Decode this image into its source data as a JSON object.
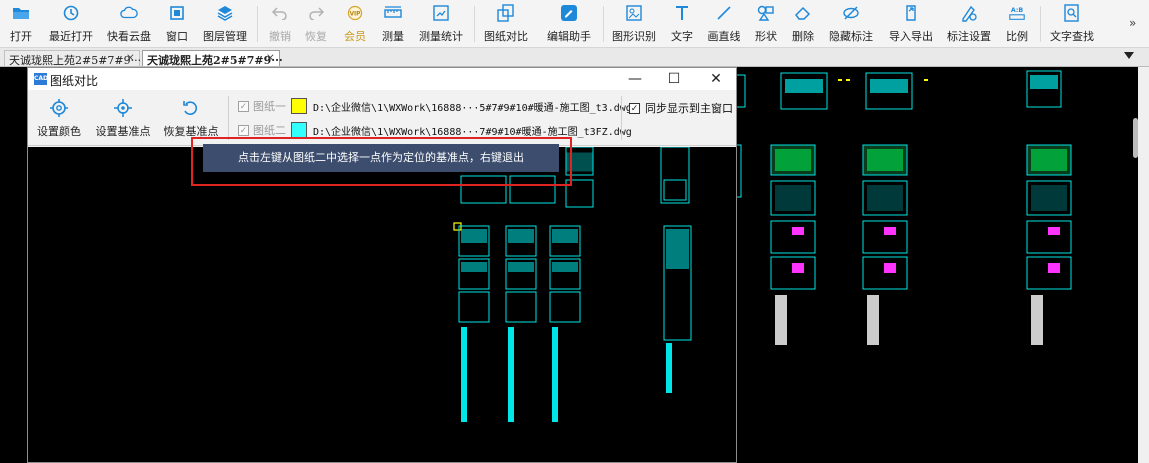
{
  "toolbar": {
    "items": [
      {
        "label": "打开",
        "icon": "folder-open-icon"
      },
      {
        "label": "最近打开",
        "icon": "recent-clock-icon"
      },
      {
        "label": "快看云盘",
        "icon": "cloud-icon"
      },
      {
        "label": "窗口",
        "icon": "window-icon"
      },
      {
        "label": "图层管理",
        "icon": "layers-icon"
      },
      {
        "label": "撤销",
        "icon": "undo-icon"
      },
      {
        "label": "恢复",
        "icon": "redo-icon"
      },
      {
        "label": "会员",
        "icon": "vip-icon"
      },
      {
        "label": "测量",
        "icon": "ruler-icon"
      },
      {
        "label": "测量统计",
        "icon": "measure-stats-icon"
      },
      {
        "label": "图纸对比",
        "icon": "compare-icon"
      },
      {
        "label": "编辑助手",
        "icon": "edit-assistant-icon"
      },
      {
        "label": "图形识别",
        "icon": "shape-recognize-icon"
      },
      {
        "label": "文字",
        "icon": "text-t-icon"
      },
      {
        "label": "画直线",
        "icon": "line-icon"
      },
      {
        "label": "形状",
        "icon": "shape-icon"
      },
      {
        "label": "删除",
        "icon": "eraser-icon"
      },
      {
        "label": "隐藏标注",
        "icon": "hide-annotation-icon"
      },
      {
        "label": "导入导出",
        "icon": "import-export-icon"
      },
      {
        "label": "标注设置",
        "icon": "annotation-settings-icon"
      },
      {
        "label": "比例",
        "icon": "scale-icon"
      },
      {
        "label": "文字查找",
        "icon": "text-search-icon"
      }
    ],
    "vip_badge": "VIP",
    "scale_badge": "A:B",
    "more": "»"
  },
  "tabs": [
    {
      "label": "天诚珑熙上苑2#5#7#9···",
      "close": "×"
    },
    {
      "label": "天诚珑熙上苑2#5#7#9···",
      "close": "×"
    }
  ],
  "dialog": {
    "title": "图纸对比",
    "logo": "CAD",
    "minimize": "—",
    "maximize": "☐",
    "close": "✕",
    "buttons": [
      {
        "label": "设置颜色",
        "icon": "palette-gear-icon"
      },
      {
        "label": "设置基准点",
        "icon": "crosshair-icon"
      },
      {
        "label": "恢复基准点",
        "icon": "restore-icon"
      }
    ],
    "files": [
      {
        "label": "图纸一",
        "color": "#ffff00",
        "path": "D:\\企业微信\\1\\WXWork\\16888···5#7#9#10#暖通-施工图_t3.dwg",
        "checked": "✓"
      },
      {
        "label": "图纸二",
        "color": "#33ffff",
        "path": "D:\\企业微信\\1\\WXWork\\16888···7#9#10#暖通-施工图_t3FZ.dwg",
        "checked": "✓"
      }
    ],
    "sync": {
      "checked": "✓",
      "label": "同步显示到主窗口"
    }
  },
  "tip": "点击左键从图纸二中选择一点作为定位的基准点，右键退出",
  "colors": {
    "cyan": "#00e5e5",
    "yellow": "#ffff00",
    "green": "#00cc44",
    "magenta": "#ff33ff",
    "highlight_red": "#e02424",
    "tip_bg": "#3c4d6e"
  }
}
